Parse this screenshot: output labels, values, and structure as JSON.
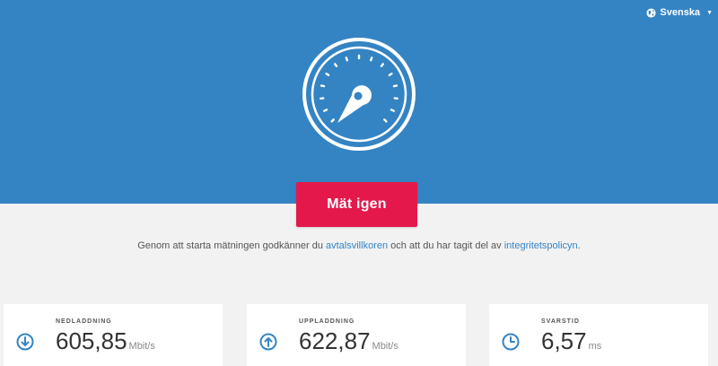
{
  "language": {
    "label": "Svenska",
    "icon": "globe-icon"
  },
  "gauge": {
    "icon": "speedometer-icon"
  },
  "action": {
    "label": "Mät igen",
    "color": "#e5184c"
  },
  "terms": {
    "prefix": "Genom att starta mätningen godkänner du ",
    "terms_link": "avtalsvillkoren",
    "middle": " och att du har tagit del av ",
    "privacy_link": "integritetspolicyn",
    "suffix": "."
  },
  "results": {
    "download": {
      "label": "NEDLADDNING",
      "value": "605,85",
      "unit": "Mbit/s",
      "icon": "arrow-down-circle-icon"
    },
    "upload": {
      "label": "UPPLADDNING",
      "value": "622,87",
      "unit": "Mbit/s",
      "icon": "arrow-up-circle-icon"
    },
    "latency": {
      "label": "SVARSTID",
      "value": "6,57",
      "unit": "ms",
      "icon": "clock-icon"
    }
  },
  "colors": {
    "header": "#3484c4",
    "accent": "#e5184c",
    "icon": "#3484c4"
  }
}
